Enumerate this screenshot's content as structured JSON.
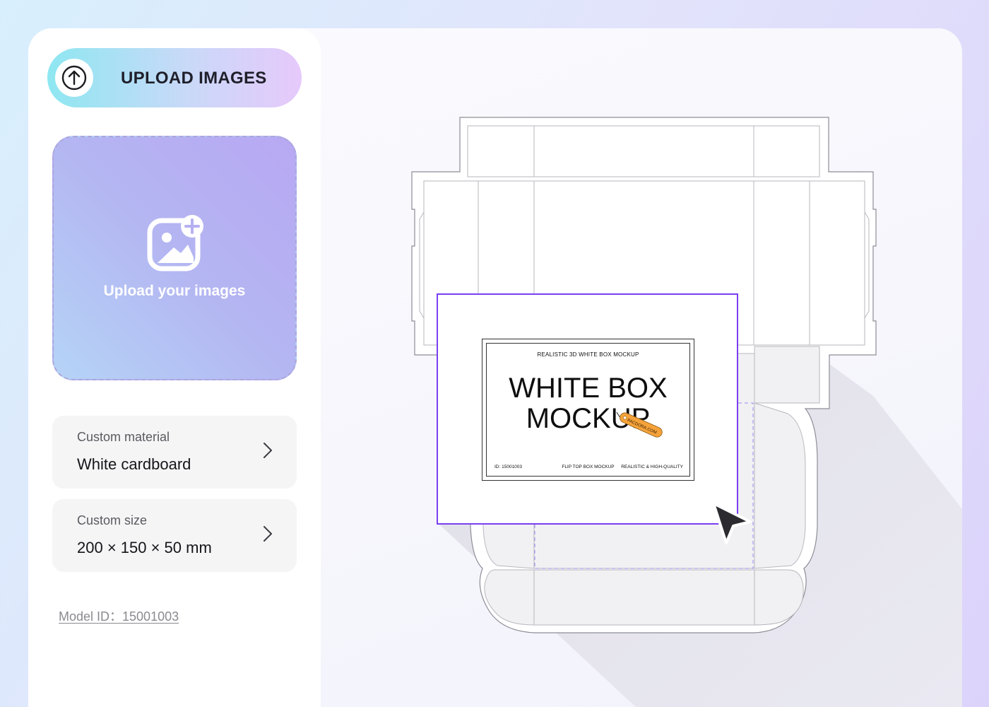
{
  "upload": {
    "label": "UPLOAD IMAGES",
    "icon": "arrow-up-circle-icon"
  },
  "dropzone": {
    "text": "Upload your images",
    "icon": "add-image-icon"
  },
  "material": {
    "label": "Custom material",
    "value": "White cardboard"
  },
  "size": {
    "label": "Custom size",
    "value": "200 × 150 × 50 mm"
  },
  "model": {
    "id_text": "Model ID：15001003"
  },
  "preview": {
    "subtitle": "REALISTIC 3D WHITE BOX MOCKUP",
    "title_line1": "WHITE BOX",
    "title_line2": "MOCKUP",
    "tag_text": "PACDORA.COM",
    "footer_left": "ID: 15001003",
    "footer_center": "FLIP TOP BOX MOCKUP",
    "footer_right": "REALISTIC & HIGH-QUALITY"
  },
  "colors": {
    "accent_purple": "#7a3ff0",
    "tag_orange": "#f5a23a",
    "upload_gradient_start": "#8ee7f1",
    "upload_gradient_end": "#e6c9fb"
  }
}
